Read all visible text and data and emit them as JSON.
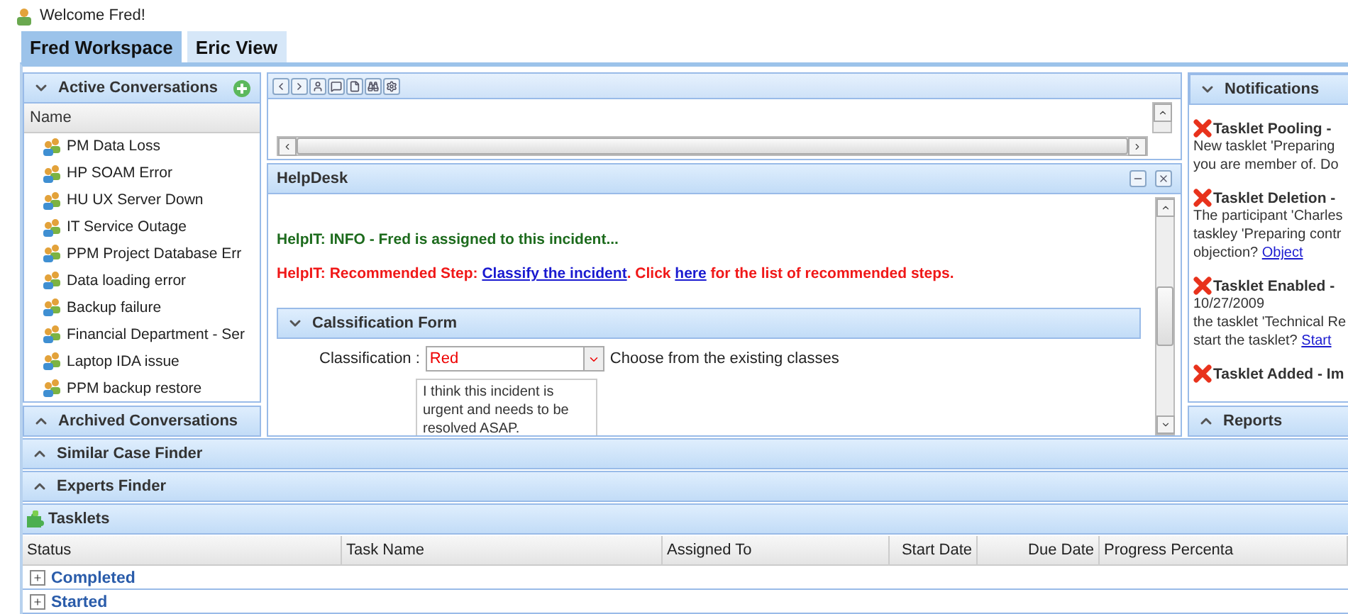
{
  "welcome": "Welcome Fred!",
  "tabs": [
    {
      "label": "Fred Workspace",
      "selected": true
    },
    {
      "label": "Eric View",
      "selected": false
    }
  ],
  "conversations": {
    "title": "Active Conversations",
    "expanded": true,
    "column": "Name",
    "items": [
      "PM Data Loss",
      "HP SOAM Error",
      "HU UX Server Down",
      "IT Service Outage",
      "PPM Project Database Err",
      "Data loading error",
      "Backup failure",
      "Financial Department - Ser",
      "Laptop IDA issue",
      "PPM backup restore"
    ]
  },
  "archived": {
    "title": "Archived Conversations",
    "expanded": false
  },
  "helpdesk": {
    "title": "HelpDesk",
    "messages": [
      {
        "kind": "info",
        "parts": [
          {
            "text": "HelpIT: INFO - Fred is assigned to this incident...",
            "kind": "text"
          }
        ]
      },
      {
        "kind": "step",
        "parts": [
          {
            "text": "HelpIT: Recommended Step: ",
            "kind": "text"
          },
          {
            "text": "Classify the incident",
            "kind": "link"
          },
          {
            "text": ". Click ",
            "kind": "text"
          },
          {
            "text": "here",
            "kind": "link"
          },
          {
            "text": " for the list of recommended steps.",
            "kind": "text"
          }
        ]
      }
    ],
    "form": {
      "title": "Calssification Form",
      "expanded": true,
      "label": "Classification :",
      "value": "Red",
      "hint": "Choose from the existing classes",
      "comment": "I think this incident is urgent and needs to be resolved ASAP."
    }
  },
  "notifications": {
    "title": "Notifications",
    "expanded": true,
    "items": [
      {
        "title": "Tasklet Pooling -",
        "lines": [
          "New tasklet 'Preparing",
          "you are member of. Do"
        ]
      },
      {
        "title": "Tasklet Deletion -",
        "lines": [
          "The participant 'Charles",
          "taskley 'Preparing contr",
          "objection?"
        ],
        "link": "Object"
      },
      {
        "title": "Tasklet Enabled -",
        "lines": [
          "10/27/2009",
          "the tasklet 'Technical Re",
          "start the tasklet?"
        ],
        "link": "Start"
      },
      {
        "title": "Tasklet Added - Im"
      }
    ]
  },
  "reports": {
    "title": "Reports",
    "expanded": false
  },
  "finders": [
    {
      "title": "Similar Case Finder",
      "expanded": false
    },
    {
      "title": "Experts Finder",
      "expanded": false
    }
  ],
  "tasklets": {
    "title": "Tasklets",
    "columns": [
      "Status",
      "Task Name",
      "Assigned To",
      "Start Date",
      "Due Date",
      "Progress Percenta"
    ],
    "groups": [
      {
        "label": "Completed",
        "expanded": false
      },
      {
        "label": "Started",
        "expanded": false
      }
    ]
  }
}
